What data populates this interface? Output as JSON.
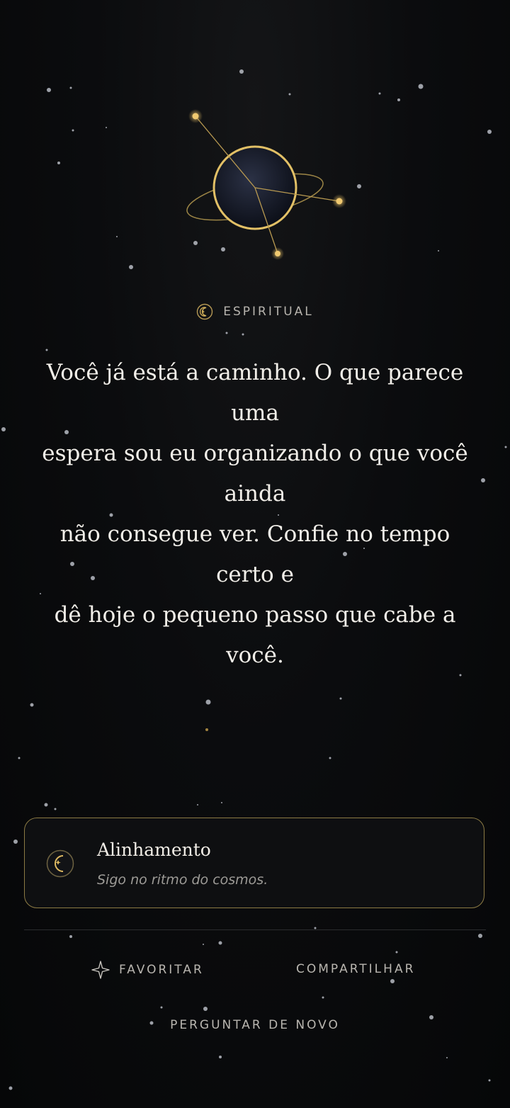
{
  "category": {
    "label": "ESPIRITUAL",
    "icon": "moon-circle-icon"
  },
  "message": [
    "Você já está a caminho. O que parece uma",
    "espera sou eu organizando o que você ainda",
    "não consegue ver. Confie no tempo certo e",
    "dê hoje o pequeno passo que cabe a você."
  ],
  "card": {
    "title": "Alinhamento",
    "subtitle": "Sigo no ritmo do cosmos.",
    "icon": "crescent-moon-icon"
  },
  "actions": {
    "favorite": "FAVORITAR",
    "favorite_icon": "sparkle-star-icon",
    "share": "COMPARTILHAR",
    "ask_again": "PERGUNTAR DE NOVO"
  },
  "colors": {
    "gold": "#d6b35b",
    "card_border": "#8b7a44",
    "background": "#0b0c0e"
  }
}
